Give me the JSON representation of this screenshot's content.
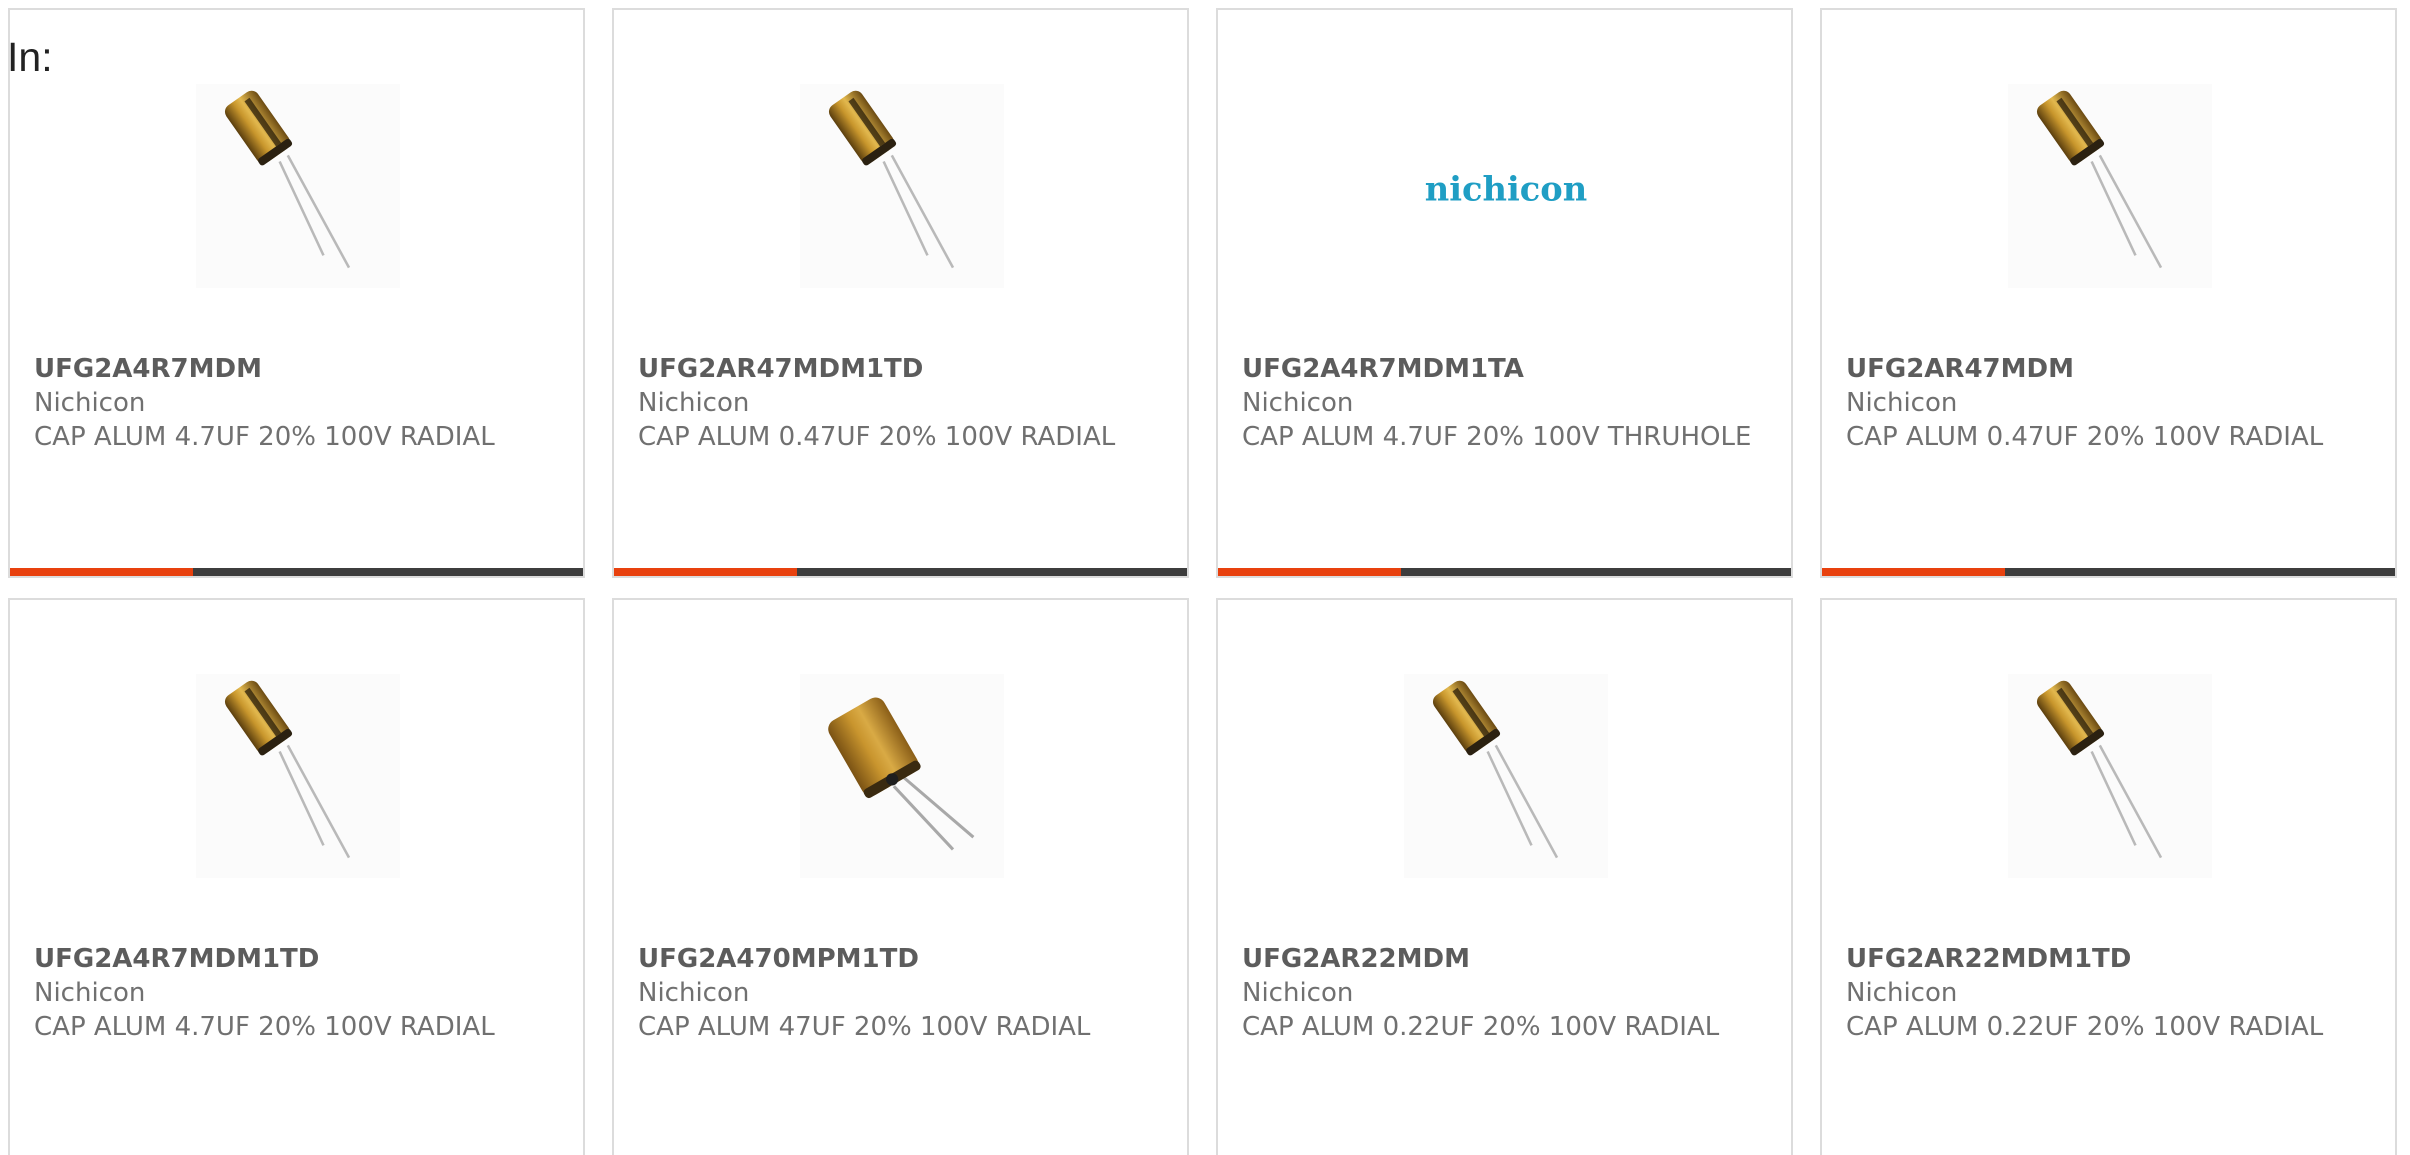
{
  "filter_label": "In:",
  "colors": {
    "accent": "#e8410e",
    "bar": "#3d3d3d",
    "logo": "#1f9ec4"
  },
  "products": [
    {
      "part_number": "UFG2A4R7MDM",
      "manufacturer": "Nichicon",
      "description": "CAP ALUM 4.7UF 20% 100V RADIAL",
      "image": "radial-capacitor-image"
    },
    {
      "part_number": "UFG2AR47MDM1TD",
      "manufacturer": "Nichicon",
      "description": "CAP ALUM 0.47UF 20% 100V RADIAL",
      "image": "radial-capacitor-image"
    },
    {
      "part_number": "UFG2A4R7MDM1TA",
      "manufacturer": "Nichicon",
      "description": "CAP ALUM 4.7UF 20% 100V THRUHOLE",
      "image": "nichicon-logo",
      "logo_text": "nichicon"
    },
    {
      "part_number": "UFG2AR47MDM",
      "manufacturer": "Nichicon",
      "description": "CAP ALUM 0.47UF 20% 100V RADIAL",
      "image": "radial-capacitor-image"
    },
    {
      "part_number": "UFG2A4R7MDM1TD",
      "manufacturer": "Nichicon",
      "description": "CAP ALUM 4.7UF 20% 100V RADIAL",
      "image": "radial-capacitor-image"
    },
    {
      "part_number": "UFG2A470MPM1TD",
      "manufacturer": "Nichicon",
      "description": "CAP ALUM 47UF 20% 100V RADIAL",
      "image": "radial-capacitor-large-image"
    },
    {
      "part_number": "UFG2AR22MDM",
      "manufacturer": "Nichicon",
      "description": "CAP ALUM 0.22UF 20% 100V RADIAL",
      "image": "radial-capacitor-image"
    },
    {
      "part_number": "UFG2AR22MDM1TD",
      "manufacturer": "Nichicon",
      "description": "CAP ALUM 0.22UF 20% 100V RADIAL",
      "image": "radial-capacitor-image"
    }
  ]
}
